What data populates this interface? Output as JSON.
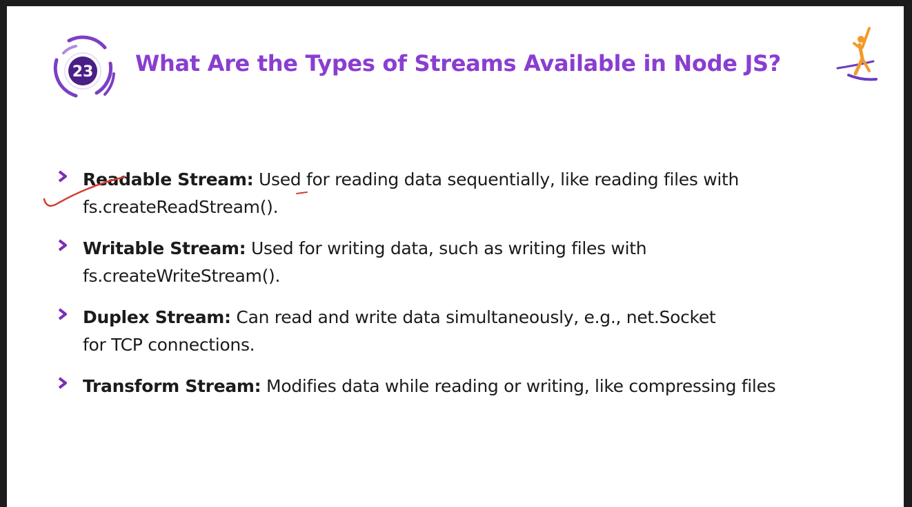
{
  "slide": {
    "badge_number": "23",
    "title": "What Are the Types of Streams Available in Node JS?",
    "items": [
      {
        "term": "Readable Stream:",
        "desc_line1": "Used for reading data sequentially, like reading files with",
        "desc_line2": "fs.createReadStream()."
      },
      {
        "term": "Writable Stream:",
        "desc_line1": "Used for writing data, such as writing files with",
        "desc_line2": "fs.createWriteStream()."
      },
      {
        "term": "Duplex Stream:",
        "desc_line1": "Can read and write data simultaneously, e.g., net.Socket",
        "desc_line2": "for TCP connections."
      },
      {
        "term": "Transform Stream:",
        "desc_line1": "Modifies data while reading or writing, like compressing files",
        "desc_line2": ""
      }
    ]
  },
  "colors": {
    "title": "#8a3ed0",
    "badge_ring": "#7b3fc4",
    "badge_inner": "#4a1f86",
    "bullet_arrow": "#7a2fb5",
    "annotation": "#d33b2f",
    "logo_orange": "#f39a2b",
    "logo_purple": "#6a3cc2"
  },
  "icons": [
    "number-badge-icon",
    "chevron-right-icon",
    "jumping-person-logo-icon"
  ]
}
